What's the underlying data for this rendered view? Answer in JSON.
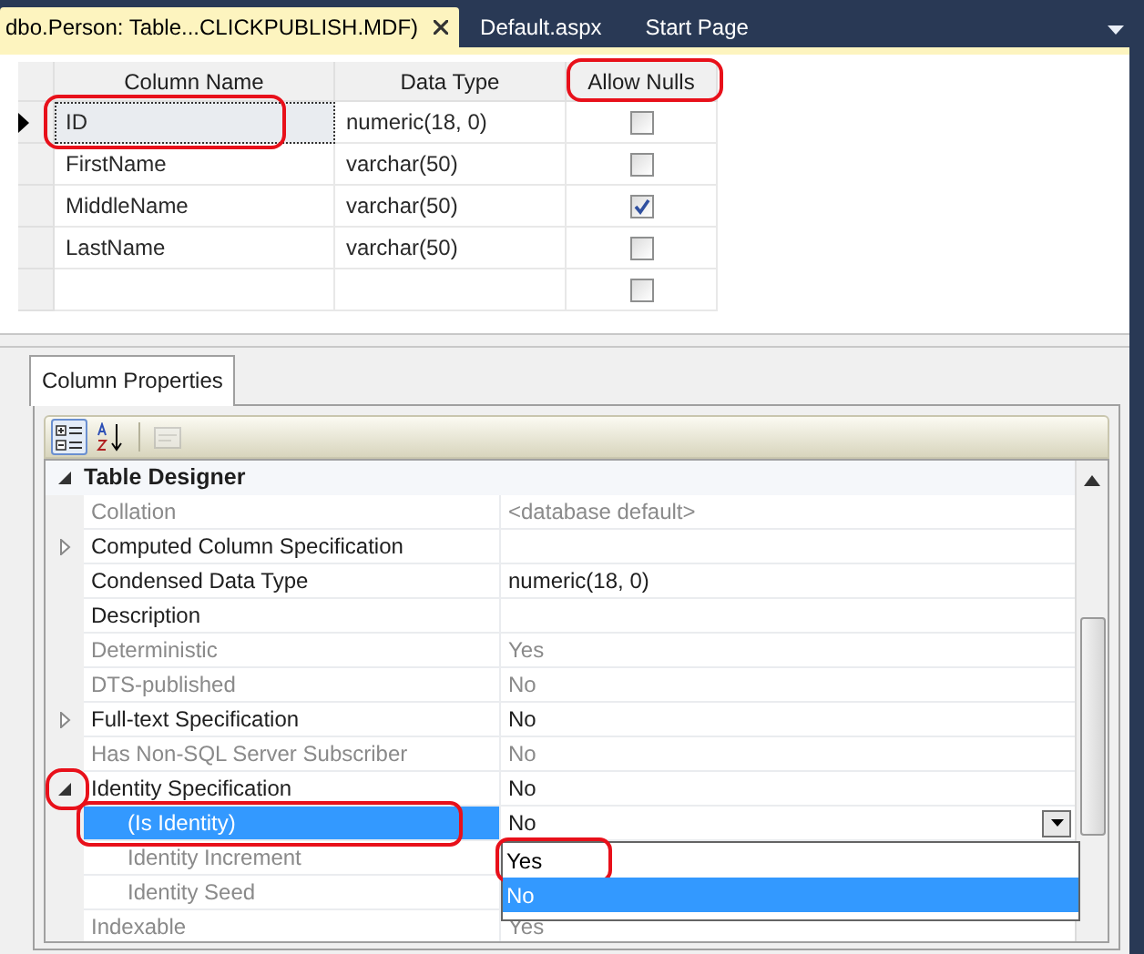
{
  "document_tabs": [
    {
      "label": "dbo.Person: Table...CLICKPUBLISH.MDF)",
      "selected": true,
      "closable": true
    },
    {
      "label": "Default.aspx",
      "selected": false,
      "closable": false
    },
    {
      "label": "Start Page",
      "selected": false,
      "closable": false
    }
  ],
  "table": {
    "columns": [
      {
        "label": "Column Name",
        "circled": false
      },
      {
        "label": "Data Type",
        "circled": false
      },
      {
        "label": "Allow Nulls",
        "circled": true
      }
    ],
    "rows": [
      {
        "name": "ID",
        "data_type": "numeric(18, 0)",
        "allow_nulls": false,
        "current": true,
        "circled": true
      },
      {
        "name": "FirstName",
        "data_type": "varchar(50)",
        "allow_nulls": false,
        "current": false,
        "circled": false
      },
      {
        "name": "MiddleName",
        "data_type": "varchar(50)",
        "allow_nulls": true,
        "current": false,
        "circled": false
      },
      {
        "name": "LastName",
        "data_type": "varchar(50)",
        "allow_nulls": false,
        "current": false,
        "circled": false
      },
      {
        "allow_nulls": false,
        "current": false,
        "circled": false
      }
    ]
  },
  "properties_tab": {
    "label": "Column Properties"
  },
  "toolbar": [
    {
      "kind": "categorized",
      "selected": true,
      "disabled": false
    },
    {
      "kind": "alphabetical",
      "selected": false,
      "disabled": false
    },
    {
      "kind": "property-pages",
      "selected": false,
      "disabled": true
    }
  ],
  "property_grid": {
    "category": {
      "label": "Table Designer",
      "expanded": true
    },
    "rows": [
      {
        "name": "Collation",
        "value": "<database default>",
        "disabled": true,
        "selected": false
      },
      {
        "name": "Computed Column Specification",
        "expandable": true,
        "expanded": false,
        "disabled": false,
        "selected": false
      },
      {
        "name": "Condensed Data Type",
        "value": "numeric(18, 0)",
        "disabled": false,
        "selected": false
      },
      {
        "name": "Description",
        "disabled": false,
        "selected": false
      },
      {
        "name": "Deterministic",
        "value": "Yes",
        "disabled": true,
        "selected": false
      },
      {
        "name": "DTS-published",
        "value": "No",
        "disabled": true,
        "selected": false
      },
      {
        "name": "Full-text Specification",
        "value": "No",
        "expandable": true,
        "expanded": false,
        "disabled": false,
        "selected": false
      },
      {
        "name": "Has Non-SQL Server Subscriber",
        "value": "No",
        "disabled": true,
        "selected": false
      },
      {
        "name": "Identity Specification",
        "value": "No",
        "expandable": true,
        "expanded": true,
        "expander_circled": true,
        "disabled": false,
        "selected": false,
        "children": [
          {
            "name": "(Is Identity)",
            "value": "No",
            "disabled": false,
            "selected": true,
            "circled": true,
            "dropdown": {
              "options": [
                {
                  "label": "Yes",
                  "selected": false,
                  "circled": true
                },
                {
                  "label": "No",
                  "selected": true,
                  "circled": false
                }
              ]
            }
          },
          {
            "name": "Identity Increment",
            "disabled": true,
            "selected": false
          },
          {
            "name": "Identity Seed",
            "disabled": true,
            "selected": false
          }
        ]
      },
      {
        "name": "Indexable",
        "value": "Yes",
        "disabled": true,
        "selected": false
      }
    ]
  }
}
